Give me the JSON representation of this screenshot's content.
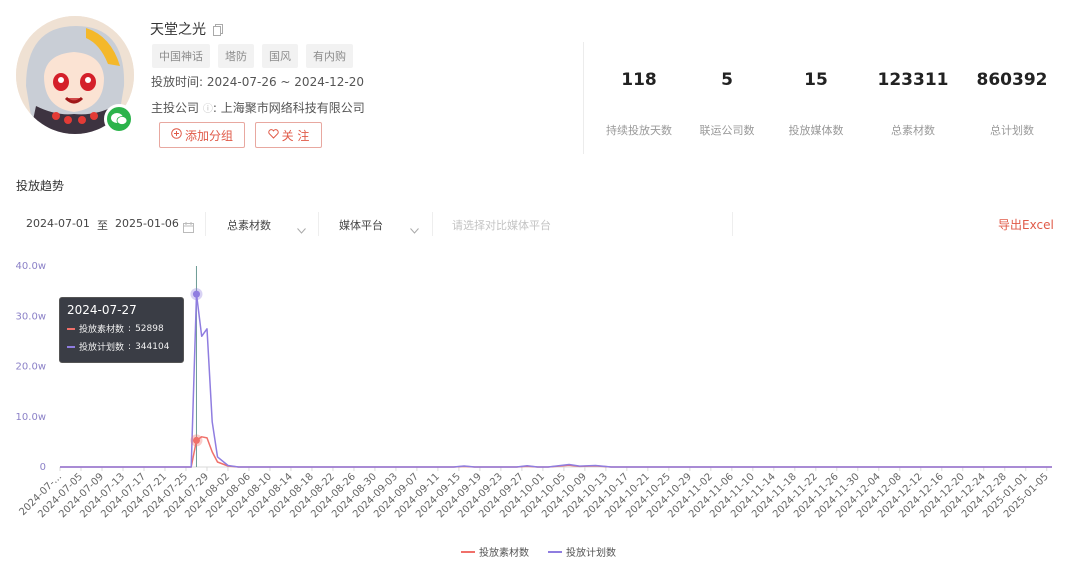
{
  "app": {
    "name": "天堂之光",
    "tags": [
      "中国神话",
      "塔防",
      "国风",
      "有内购"
    ],
    "date_label": "投放时间:",
    "date_range": "2024-07-26 ~ 2024-12-20",
    "company_label": "主投公司",
    "company_colon": ":",
    "company_name": "上海聚市网络科技有限公司",
    "add_group_label": "添加分组",
    "follow_label": "关 注"
  },
  "stats": [
    {
      "value": "118",
      "label": "持续投放天数"
    },
    {
      "value": "5",
      "label": "联运公司数"
    },
    {
      "value": "15",
      "label": "投放媒体数"
    },
    {
      "value": "123311",
      "label": "总素材数"
    },
    {
      "value": "860392",
      "label": "总计划数"
    }
  ],
  "section_title": "投放趋势",
  "filters": {
    "start_date": "2024-07-01",
    "to_label": "至",
    "end_date": "2025-01-06",
    "metric_select": "总素材数",
    "platform_select": "媒体平台",
    "compare_placeholder": "请选择对比媒体平台",
    "export_label": "导出Excel"
  },
  "colors": {
    "accent": "#e05a48",
    "series_material": "#f0706a",
    "series_plan": "#8f7de0"
  },
  "chart_data": {
    "type": "line",
    "yticks": [
      "40.0w",
      "30.0w",
      "20.0w",
      "10.0w",
      "0"
    ],
    "ylim": [
      0,
      400000
    ],
    "x": [
      "2024-07-01",
      "2024-07-05",
      "2024-07-09",
      "2024-07-13",
      "2024-07-17",
      "2024-07-21",
      "2024-07-25",
      "2024-07-29",
      "2024-08-02",
      "2024-08-06",
      "2024-08-10",
      "2024-08-14",
      "2024-08-18",
      "2024-08-22",
      "2024-08-26",
      "2024-08-30",
      "2024-09-03",
      "2024-09-07",
      "2024-09-11",
      "2024-09-15",
      "2024-09-19",
      "2024-09-23",
      "2024-09-27",
      "2024-10-01",
      "2024-10-05",
      "2024-10-09",
      "2024-10-13",
      "2024-10-17",
      "2024-10-21",
      "2024-10-25",
      "2024-10-29",
      "2024-11-02",
      "2024-11-06",
      "2024-11-10",
      "2024-11-14",
      "2024-11-18",
      "2024-11-22",
      "2024-11-26",
      "2024-11-30",
      "2024-12-04",
      "2024-12-08",
      "2024-12-12",
      "2024-12-16",
      "2024-12-20",
      "2024-12-24",
      "2024-12-28",
      "2025-01-01",
      "2025-01-05"
    ],
    "x_tick_labels": [
      "2024-07-...",
      "2024-07-05",
      "2024-07-09",
      "2024-07-13",
      "2024-07-17",
      "2024-07-21",
      "2024-07-25",
      "2024-07-29",
      "2024-08-02",
      "2024-08-06",
      "2024-08-10",
      "2024-08-14",
      "2024-08-18",
      "2024-08-22",
      "2024-08-26",
      "2024-08-30",
      "2024-09-03",
      "2024-09-07",
      "2024-09-11",
      "2024-09-15",
      "2024-09-19",
      "2024-09-23",
      "2024-09-27",
      "2024-10-01",
      "2024-10-05",
      "2024-10-09",
      "2024-10-13",
      "2024-10-17",
      "2024-10-21",
      "2024-10-25",
      "2024-10-29",
      "2024-11-02",
      "2024-11-06",
      "2024-11-10",
      "2024-11-14",
      "2024-11-18",
      "2024-11-22",
      "2024-11-26",
      "2024-11-30",
      "2024-12-04",
      "2024-12-08",
      "2024-12-12",
      "2024-12-16",
      "2024-12-20",
      "2024-12-24",
      "2024-12-28",
      "2025-01-01",
      "2025-01-05"
    ],
    "series": [
      {
        "name": "投放素材数",
        "points": [
          [
            "2024-07-01",
            0
          ],
          [
            "2024-07-26",
            0
          ],
          [
            "2024-07-27",
            52898
          ],
          [
            "2024-07-28",
            60000
          ],
          [
            "2024-07-29",
            58000
          ],
          [
            "2024-07-30",
            30000
          ],
          [
            "2024-07-31",
            10000
          ],
          [
            "2024-08-02",
            2000
          ],
          [
            "2024-08-04",
            0
          ],
          [
            "2024-09-14",
            0
          ],
          [
            "2024-09-16",
            1200
          ],
          [
            "2024-09-18",
            0
          ],
          [
            "2024-09-26",
            0
          ],
          [
            "2024-09-28",
            1500
          ],
          [
            "2024-09-30",
            0
          ],
          [
            "2024-10-02",
            0
          ],
          [
            "2024-10-06",
            3500
          ],
          [
            "2024-10-08",
            1200
          ],
          [
            "2024-10-11",
            2200
          ],
          [
            "2024-10-14",
            0
          ],
          [
            "2025-01-06",
            0
          ]
        ]
      },
      {
        "name": "投放计划数",
        "points": [
          [
            "2024-07-01",
            0
          ],
          [
            "2024-07-26",
            0
          ],
          [
            "2024-07-27",
            344104
          ],
          [
            "2024-07-28",
            260000
          ],
          [
            "2024-07-29",
            275000
          ],
          [
            "2024-07-30",
            90000
          ],
          [
            "2024-07-31",
            20000
          ],
          [
            "2024-08-02",
            3000
          ],
          [
            "2024-08-04",
            0
          ],
          [
            "2024-09-14",
            0
          ],
          [
            "2024-09-16",
            2000
          ],
          [
            "2024-09-18",
            0
          ],
          [
            "2024-09-26",
            0
          ],
          [
            "2024-09-28",
            2500
          ],
          [
            "2024-09-30",
            0
          ],
          [
            "2024-10-02",
            0
          ],
          [
            "2024-10-06",
            5000
          ],
          [
            "2024-10-08",
            1800
          ],
          [
            "2024-10-11",
            3000
          ],
          [
            "2024-10-14",
            0
          ],
          [
            "2025-01-06",
            0
          ]
        ]
      }
    ],
    "hover": {
      "date": "2024-07-27",
      "rows": [
        {
          "label": "投放素材数",
          "value": "52898"
        },
        {
          "label": "投放计划数",
          "value": "344104"
        }
      ]
    },
    "legend": [
      "投放素材数",
      "投放计划数"
    ],
    "legend_position": "bottom-center",
    "grid": false
  }
}
